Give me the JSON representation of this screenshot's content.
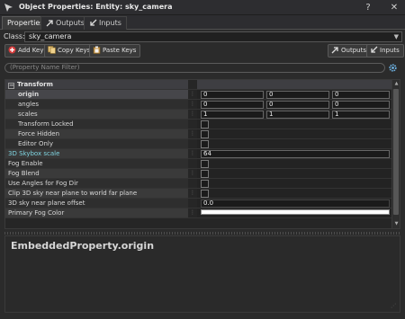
{
  "window": {
    "title": "Object Properties: Entity: sky_camera",
    "help_label": "?",
    "close_label": "✕"
  },
  "tabs": [
    {
      "label": "Properties",
      "active": true
    },
    {
      "label": "Outputs",
      "active": false
    },
    {
      "label": "Inputs",
      "active": false
    }
  ],
  "class_row": {
    "label": "Class:",
    "value": "sky_camera"
  },
  "toolbar": {
    "add_key": "Add Key",
    "copy_keys": "Copy Keys",
    "paste_keys": "Paste Keys",
    "outputs": "Outputs",
    "inputs": "Inputs"
  },
  "filter": {
    "placeholder": "(Property Name Filter)"
  },
  "grid": {
    "section": "Transform",
    "rows": [
      {
        "name": "origin",
        "values": [
          "0",
          "0",
          "0"
        ]
      },
      {
        "name": "angles",
        "values": [
          "0",
          "0",
          "0"
        ]
      },
      {
        "name": "scales",
        "values": [
          "1",
          "1",
          "1"
        ]
      },
      {
        "name": "Transform Locked"
      },
      {
        "name": "Force Hidden"
      },
      {
        "name": "Editor Only"
      },
      {
        "name": "3D Skybox scale",
        "value": "64"
      },
      {
        "name": "Fog Enable"
      },
      {
        "name": "Fog Blend"
      },
      {
        "name": "Use Angles for Fog Dir"
      },
      {
        "name": "Clip 3D sky near plane to world far plane"
      },
      {
        "name": "3D sky near plane offset",
        "value": "0.0"
      },
      {
        "name": "Primary Fog Color"
      }
    ]
  },
  "info": {
    "title": "EmbeddedProperty.origin"
  },
  "colors": {
    "accent_teal": "#7fd4e0",
    "add_icon_red": "#d83a3a",
    "fog_color": "#ffffff"
  },
  "icons": [
    "app-icon",
    "help-icon",
    "close-icon",
    "outputs-arrow-icon",
    "inputs-arrow-icon",
    "add-key-icon",
    "copy-keys-icon",
    "paste-keys-icon",
    "settings-gear-icon"
  ]
}
